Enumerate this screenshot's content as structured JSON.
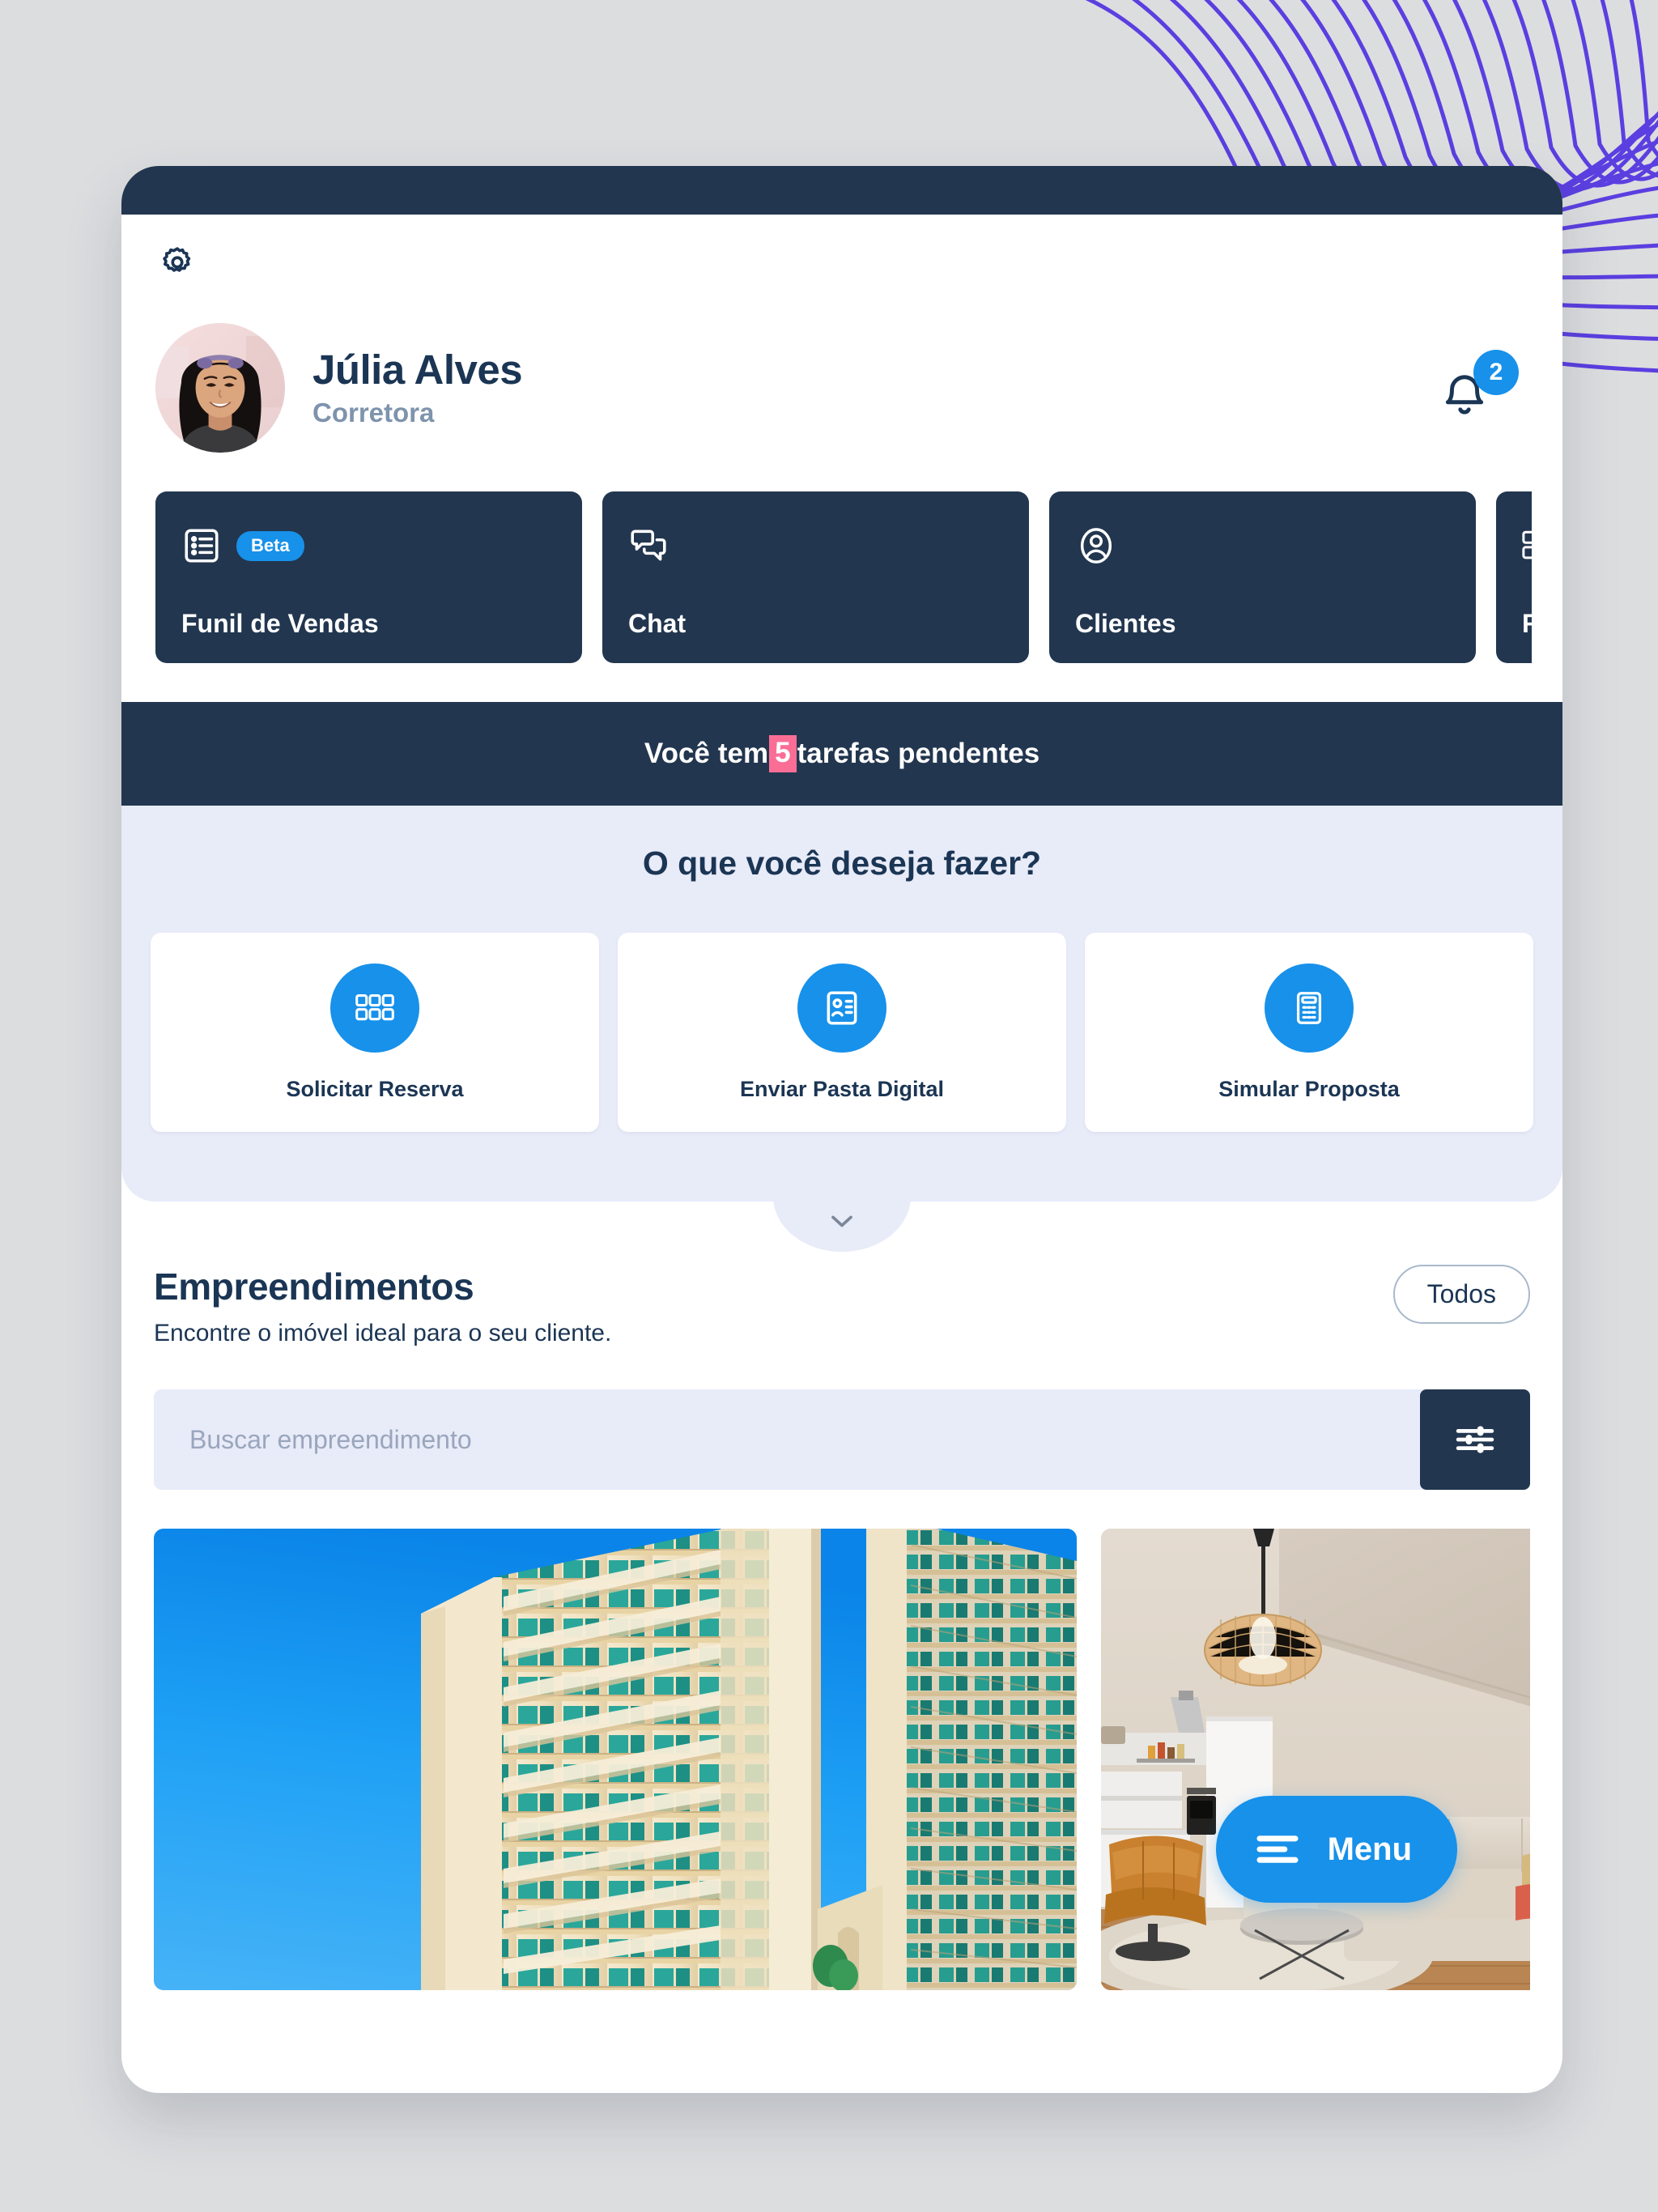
{
  "theme": {
    "navy": "#22364f",
    "navy_text": "#1b3554",
    "accent_blue": "#1791ea",
    "panel_lavender": "#e8ebf8",
    "pink_highlight": "#fa6e96",
    "page_bg": "#dcdddf",
    "deco_purple": "#5b3fe0"
  },
  "header": {
    "gear_icon": "gear-icon",
    "profile": {
      "name": "Júlia Alves",
      "role": "Corretora",
      "avatar_icon": "avatar"
    },
    "notifications": {
      "icon": "bell-icon",
      "count": "2"
    }
  },
  "nav_cards": [
    {
      "label": "Funil de Vendas",
      "icon": "list-icon",
      "badge": "Beta"
    },
    {
      "label": "Chat",
      "icon": "chat-bubbles-icon",
      "badge": ""
    },
    {
      "label": "Clientes",
      "icon": "user-circle-icon",
      "badge": ""
    },
    {
      "label": "Reserv",
      "icon": "grid-blocks-icon",
      "badge": ""
    }
  ],
  "tasks_banner": {
    "prefix": "Você",
    "middle": "tem",
    "count": "5",
    "suffix": "tarefas pendentes"
  },
  "quick_actions": {
    "title": "O que você deseja fazer?",
    "items": [
      {
        "label": "Solicitar Reserva",
        "icon": "grid-blocks-icon"
      },
      {
        "label": "Enviar Pasta Digital",
        "icon": "id-card-icon"
      },
      {
        "label": "Simular Proposta",
        "icon": "calculator-icon"
      }
    ],
    "collapse_icon": "chevron-down-icon"
  },
  "listings": {
    "title": "Empreendimentos",
    "subtitle": "Encontre o imóvel ideal para o seu cliente.",
    "filter_pill": "Todos",
    "search": {
      "value": "",
      "placeholder": "Buscar empreendimento",
      "filter_icon": "sliders-icon"
    },
    "properties": [
      {
        "alt": "Condomínio de torres residenciais sob céu azul"
      },
      {
        "alt": "Sala de estar integrada com cozinha"
      }
    ]
  },
  "menu_fab": {
    "label": "Menu",
    "icon": "hamburger-icon"
  }
}
